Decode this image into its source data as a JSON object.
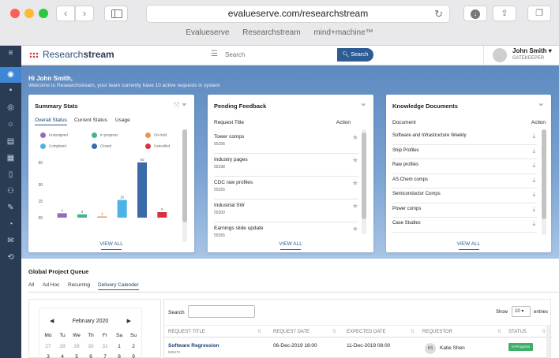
{
  "browser": {
    "url": "evalueserve.com/researchstream",
    "bookmarks": [
      "Evalueserve",
      "Researchstream",
      "mind+machine™"
    ]
  },
  "app": {
    "logo_prefix": "Research",
    "logo_suffix": "stream",
    "search_placeholder": "Search",
    "search_button": "Search",
    "user_name": "John Smith ▾",
    "user_role": "GATEKEEPER"
  },
  "hero": {
    "greeting": "Hi John Smith,",
    "message": "Welcome to Researchstream, your team currently have 10 active requests in system"
  },
  "summary": {
    "title": "Summary Stats",
    "tabs": [
      "Overall Status",
      "Current Status",
      "Usage"
    ],
    "legend": [
      {
        "label": "Unassigned",
        "color": "#8e6cc0"
      },
      {
        "label": "In progress",
        "color": "#45b393"
      },
      {
        "label": "On-hold",
        "color": "#f0944a"
      },
      {
        "label": "Completed",
        "color": "#4db3e6"
      },
      {
        "label": "Closed",
        "color": "#3a6aa8"
      },
      {
        "label": "Cancelled",
        "color": "#d7323f"
      }
    ],
    "view_all": "VIEW ALL"
  },
  "chart_data": {
    "type": "bar",
    "categories": [
      "Unassigned",
      "In progress",
      "On-hold",
      "Completed",
      "Closed",
      "Cancelled"
    ],
    "values": [
      4,
      3,
      1,
      16,
      50,
      5
    ],
    "ylim": [
      0,
      50
    ],
    "yticks": [
      0,
      15,
      30,
      50
    ],
    "colors": [
      "#8e6cc0",
      "#45b393",
      "#f0944a",
      "#4db3e6",
      "#3a6aa8",
      "#d7323f"
    ]
  },
  "pending": {
    "title": "Pending Feedback",
    "col_title": "Request Title",
    "col_action": "Action",
    "rows": [
      {
        "title": "Tower comps",
        "id": "55396"
      },
      {
        "title": "Industry pages",
        "id": "55398"
      },
      {
        "title": "CDC raw profiles",
        "id": "55355"
      },
      {
        "title": "Industrial SW",
        "id": "55300"
      },
      {
        "title": "Earnings slide update",
        "id": "55365"
      }
    ],
    "view_all": "VIEW ALL"
  },
  "knowledge": {
    "title": "Knowledge Documents",
    "col_doc": "Document",
    "col_action": "Action",
    "rows": [
      "Software and Infrastructure Weekly",
      "Ship Profiles",
      "Raw profiles",
      "AS Chem comps",
      "Semiconductor Comps",
      "Power comps",
      "Case Studies"
    ],
    "view_all": "VIEW ALL"
  },
  "queue": {
    "title": "Global Project Queue",
    "tabs": [
      "All",
      "Ad Hoc",
      "Recurring",
      "Delivery Calender"
    ]
  },
  "calendar": {
    "month": "February 2020",
    "weekdays": [
      "Mo",
      "Tu",
      "We",
      "Th",
      "Fr",
      "Sa",
      "Su"
    ],
    "rows": [
      [
        "27",
        "28",
        "29",
        "30",
        "31",
        "1",
        "2"
      ],
      [
        "3",
        "4",
        "5",
        "6",
        "7",
        "8",
        "9"
      ]
    ]
  },
  "table": {
    "search_label": "Search",
    "show_label": "Show",
    "show_value": "10",
    "entries_label": "entries",
    "columns": [
      "REQUEST TITLE",
      "REQUEST DATE",
      "EXPECTED DATE",
      "REQUESTOR",
      "STATUS"
    ],
    "row": {
      "title": "Software Regression",
      "id": "555373",
      "request_date": "06-Dec-2019 18:00",
      "expected_date": "11-Dec-2019 08:00",
      "requestor_initials": "KS",
      "requestor": "Katie Shen",
      "status": "In-Progress"
    }
  }
}
